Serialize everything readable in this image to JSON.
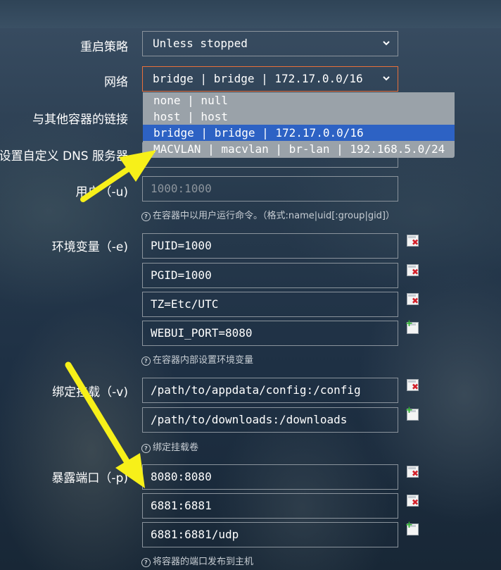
{
  "labels": {
    "restart": "重启策略",
    "network": "网络",
    "links": "与其他容器的链接",
    "dns": "设置自定义 DNS 服务器",
    "user": "用户（-u)",
    "env": "环境变量（-e)",
    "mount": "绑定挂载（-v)",
    "ports": "暴露端口（-p)"
  },
  "restart_policy": {
    "value": "Unless stopped"
  },
  "network": {
    "value": "bridge | bridge | 172.17.0.0/16",
    "options": [
      "none | null",
      "host | host",
      "bridge | bridge | 172.17.0.0/16",
      "MACVLAN | macvlan | br-lan | 192.168.5.0/24"
    ],
    "selected_index": 2
  },
  "user": {
    "placeholder": "1000:1000"
  },
  "hints": {
    "user": "在容器中以用户运行命令。（格式:name|uid[:group|gid]）",
    "env": "在容器内部设置环境变量",
    "mount": "绑定挂载卷",
    "ports": "将容器的端口发布到主机"
  },
  "env": [
    "PUID=1000",
    "PGID=1000",
    "TZ=Etc/UTC",
    "WEBUI_PORT=8080"
  ],
  "mounts": [
    "/path/to/appdata/config:/config",
    "/path/to/downloads:/downloads"
  ],
  "ports": [
    "8080:8080",
    "6881:6881",
    "6881:6881/udp"
  ],
  "colors": {
    "focus_border": "#e9703a",
    "selected_option": "#2d62c4",
    "annotation_arrow": "#f7f019",
    "remove_icon": "#d4202a",
    "add_icon": "#2bb52b"
  },
  "icons": {
    "remove": "remove-row-icon",
    "add": "add-row-icon",
    "help": "help-circle-icon",
    "select": "chevron-down-icon"
  }
}
